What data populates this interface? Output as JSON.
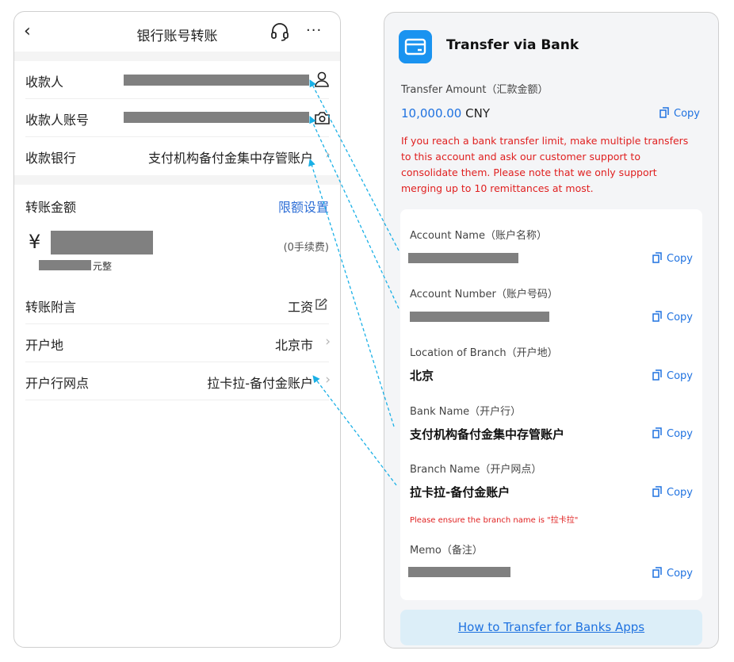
{
  "left": {
    "title": "银行账号转账",
    "back_glyph": "‹",
    "more_glyph": "···",
    "icons": {
      "headset": "headset-icon",
      "more": "more-icon",
      "person": "person-icon",
      "camera": "camera-icon",
      "edit": "edit-icon",
      "chevron": "chevron-right-icon"
    },
    "payee_label": "收款人",
    "payee_account_label": "收款人账号",
    "bank_label": "收款银行",
    "bank_value": "支付机构备付金集中存管账户",
    "amount_label": "转账金额",
    "limit_link": "限额设置",
    "currency_symbol": "¥",
    "fee_text": "(0手续费)",
    "amount_words_suffix": "元整",
    "memo_label": "转账附言",
    "memo_value": "工资",
    "location_label": "开户地",
    "location_value": "北京市",
    "branch_label": "开户行网点",
    "branch_value": "拉卡拉-备付金账户"
  },
  "right": {
    "title": "Transfer via Bank",
    "amount_label": "Transfer Amount（汇款金额）",
    "amount_value": "10,000.00",
    "amount_currency": "CNY",
    "copy_label": "Copy",
    "warning": "If you reach a bank transfer limit, make multiple transfers to this account and ask our customer support to consolidate them. Please note that we only support merging up to 10 remittances at most.",
    "fields": {
      "account_name_label": "Account Name（账户名称）",
      "account_number_label": "Account Number（账户号码）",
      "location_label": "Location of Branch（开户地）",
      "location_value": "北京",
      "bank_name_label": "Bank Name（开户行）",
      "bank_name_value": "支付机构备付金集中存管账户",
      "branch_name_label": "Branch Name（开户网点）",
      "branch_name_value": "拉卡拉-备付金账户",
      "branch_note": "Please ensure the branch name is \"拉卡拉\"",
      "memo_label": "Memo（备注）"
    },
    "how_to_link": "How to Transfer for Banks Apps"
  },
  "colors": {
    "accent_blue": "#1f72e0",
    "warning_red": "#e02020",
    "app_icon_blue": "#1a93f0",
    "redaction_gray": "#808080",
    "arrow_cyan": "#1ab0e6"
  }
}
